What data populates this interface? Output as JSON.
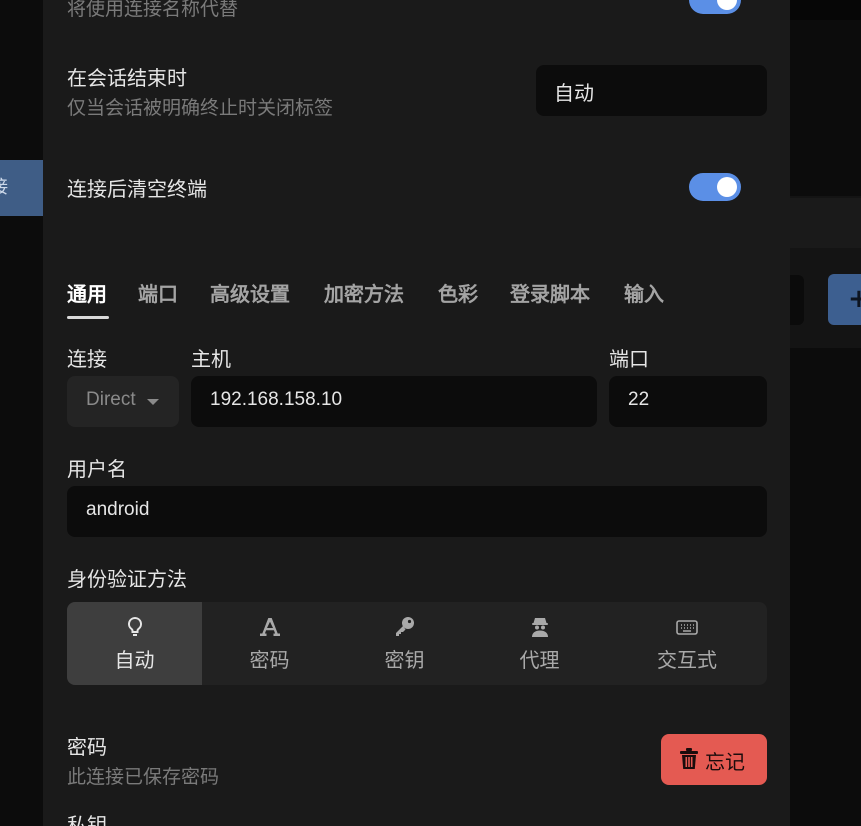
{
  "background": {
    "left_item_label": "接",
    "plus_label": "+"
  },
  "settings": {
    "name_hint": "将使用连接名称代替",
    "on_session_end": {
      "label": "在会话结束时",
      "desc": "仅当会话被明确终止时关闭标签",
      "value": "自动"
    },
    "clear_terminal": {
      "label": "连接后清空终端",
      "enabled": true
    }
  },
  "tabs": [
    "通用",
    "端口",
    "高级设置",
    "加密方法",
    "色彩",
    "登录脚本",
    "输入"
  ],
  "active_tab": "通用",
  "form": {
    "connection_label": "连接",
    "connection_value": "Direct",
    "host_label": "主机",
    "host_value": "192.168.158.10",
    "port_label": "端口",
    "port_value": "22",
    "username_label": "用户名",
    "username_value": "android",
    "auth_label": "身份验证方法",
    "auth_methods": [
      {
        "label": "自动",
        "icon": "lightbulb-icon"
      },
      {
        "label": "密码",
        "icon": "font-a-icon"
      },
      {
        "label": "密钥",
        "icon": "key-icon"
      },
      {
        "label": "代理",
        "icon": "user-secret-icon"
      },
      {
        "label": "交互式",
        "icon": "keyboard-icon"
      }
    ],
    "active_auth": "自动",
    "password_label": "密码",
    "password_desc": "此连接已保存密码",
    "forget_label": "忘记",
    "private_key_label": "私钥"
  },
  "colors": {
    "accent": "#5b8fe6",
    "danger": "#e45a52",
    "modal_bg": "#1a1a1a"
  }
}
